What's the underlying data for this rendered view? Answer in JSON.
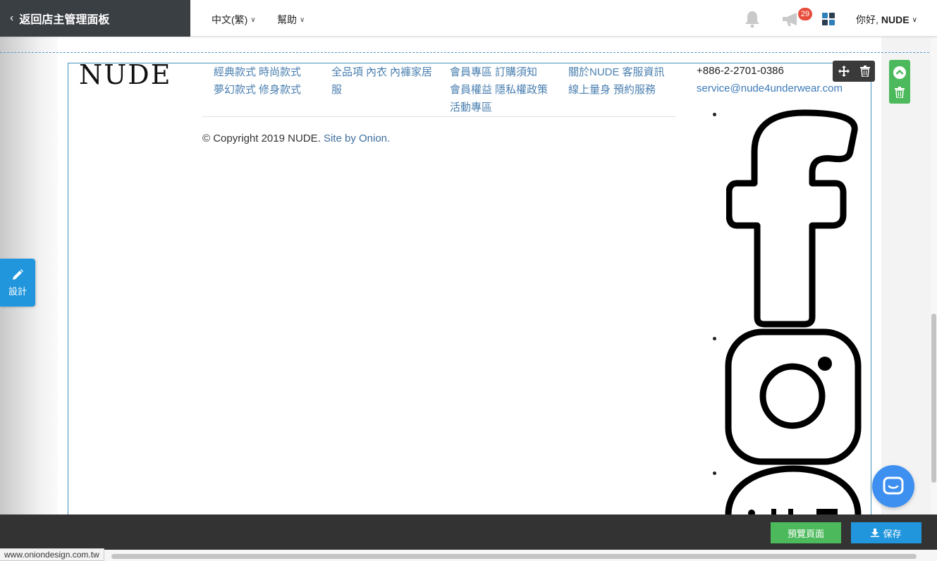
{
  "topbar": {
    "back_label": "返回店主管理面板",
    "language_label": "中文(繁)",
    "help_label": "幫助",
    "notification_count": "29",
    "greeting": "你好,",
    "username": "NUDE"
  },
  "footer": {
    "logo_text": "NUDE",
    "columns": [
      [
        "經典款式",
        "時尚款式",
        "夢幻款式",
        "修身款式"
      ],
      [
        "全品項",
        "內衣",
        "內褲家居服"
      ],
      [
        "會員專區",
        "訂購須知",
        "會員權益",
        "隱私權政策",
        "活動專區"
      ],
      [
        "關於NUDE",
        "客服資訊",
        "線上量身",
        "預約服務"
      ]
    ],
    "copyright_text": "© Copyright 2019 NUDE.",
    "site_by": "Site by Onion.",
    "phone": "+886-2-2701-0386",
    "email": "service@nude4underwear.com",
    "social_icons": [
      "facebook-icon",
      "instagram-icon",
      "line-icon"
    ]
  },
  "sidebar": {
    "design_label": "設計"
  },
  "actions": {
    "preview_label": "預覽頁面",
    "save_label": "保存"
  },
  "status": {
    "url": "www.oniondesign.com.tw"
  },
  "colors": {
    "topbar_dark": "#3a3f44",
    "link_blue": "#4a7fb0",
    "accent_blue": "#2196dd",
    "accent_green": "#4cba5c",
    "badge_red": "#e74c3c",
    "bottombar": "#333333"
  }
}
